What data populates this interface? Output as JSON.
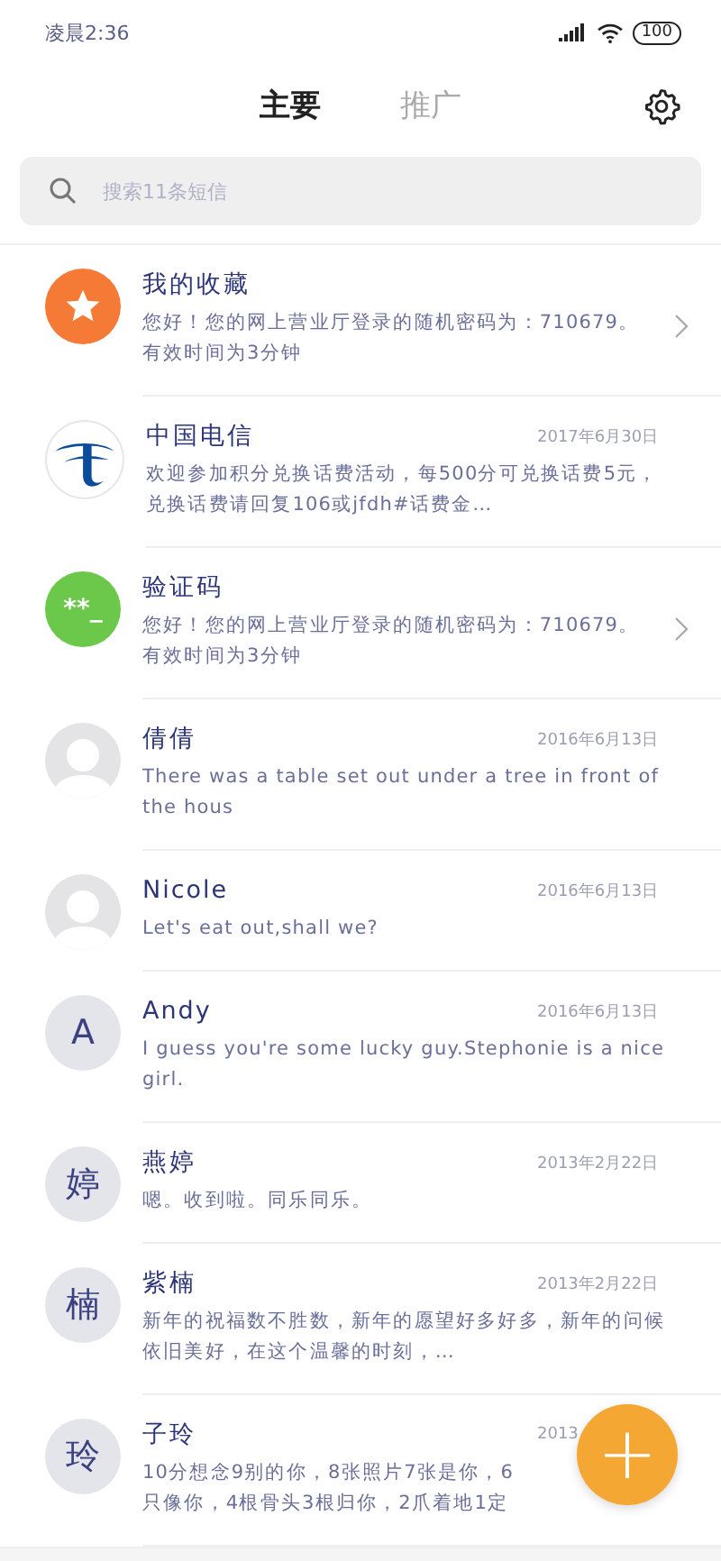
{
  "status_bar": {
    "time": "凌晨2:36",
    "battery": "100"
  },
  "tabs": [
    {
      "label": "主要",
      "selected": true
    },
    {
      "label": "推广",
      "selected": false
    }
  ],
  "search": {
    "placeholder": "搜索11条短信"
  },
  "messages": [
    {
      "kind": "star",
      "name": "我的收藏",
      "preview": "您好！您的网上营业厅登录的随机密码为：710679。有效时间为3分钟",
      "chevron": true
    },
    {
      "kind": "telecom",
      "name": "中国电信",
      "date": "2017年6月30日",
      "preview": "欢迎参加积分兑换话费活动，每500分可兑换话费5元，兑换话费请回复106或jfdh#话费金…"
    },
    {
      "kind": "code",
      "avatar_text": "**_",
      "name": "验证码",
      "preview": "您好！您的网上营业厅登录的随机密码为：710679。有效时间为3分钟",
      "chevron": true
    },
    {
      "kind": "person",
      "name": "倩倩",
      "date": "2016年6月13日",
      "preview": "There was a table set out under a tree in front of the hous"
    },
    {
      "kind": "person",
      "name": "Nicole",
      "date": "2016年6月13日",
      "preview": "Let's eat out,shall we?"
    },
    {
      "kind": "letter",
      "avatar_text": "A",
      "name": "Andy",
      "date": "2016年6月13日",
      "preview": "I guess you're some lucky guy.Stephonie is a nice girl."
    },
    {
      "kind": "letter",
      "avatar_text": "婷",
      "name": "燕婷",
      "date": "2013年2月22日",
      "preview": "嗯。收到啦。同乐同乐。"
    },
    {
      "kind": "letter",
      "avatar_text": "楠",
      "name": "紫楠",
      "date": "2013年2月22日",
      "preview": "新年的祝福数不胜数，新年的愿望好多好多，新年的问候依旧美好，在这个温馨的时刻，…"
    },
    {
      "kind": "letter",
      "avatar_text": "玲",
      "name": "子玲",
      "date": "2013",
      "preview": "10分想念9别的你，8张照片7张是你，6\n只像你，4根骨头3根归你，2爪着地1定"
    }
  ],
  "fab": {
    "label": "+"
  }
}
